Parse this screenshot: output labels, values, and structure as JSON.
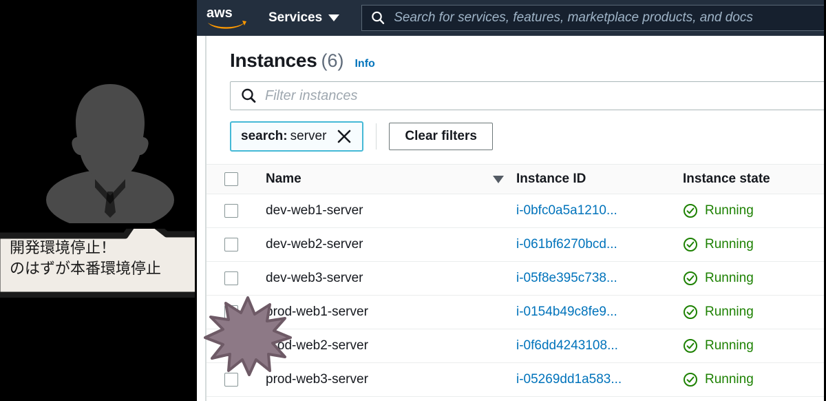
{
  "nav": {
    "logo": "aws-logo",
    "services_label": "Services",
    "search_placeholder": "Search for services, features, marketplace products, and docs",
    "search_icon": "search-icon",
    "caret_icon": "chevron-down-icon"
  },
  "page": {
    "title": "Instances",
    "count": "(6)",
    "info_label": "Info"
  },
  "filter": {
    "placeholder": "Filter instances",
    "search_icon": "search-icon",
    "chip_key": "search:",
    "chip_value": "server",
    "chip_remove_icon": "close-icon",
    "clear_label": "Clear filters"
  },
  "table": {
    "columns": [
      "Name",
      "Instance ID",
      "Instance state"
    ],
    "sort_icon": "sort-descending-icon",
    "rows": [
      {
        "name": "dev-web1-server",
        "id": "i-0bfc0a5a1210...",
        "state": "Running",
        "state_icon": "check-circle-icon"
      },
      {
        "name": "dev-web2-server",
        "id": "i-061bf6270bcd...",
        "state": "Running",
        "state_icon": "check-circle-icon"
      },
      {
        "name": "dev-web3-server",
        "id": "i-05f8e395c738...",
        "state": "Running",
        "state_icon": "check-circle-icon"
      },
      {
        "name": "prod-web1-server",
        "id": "i-0154b49c8fe9...",
        "state": "Running",
        "state_icon": "check-circle-icon"
      },
      {
        "name": "prod-web2-server",
        "id": "i-0f6dd4243108...",
        "state": "Running",
        "state_icon": "check-circle-icon"
      },
      {
        "name": "prod-web3-server",
        "id": "i-05269dd1a583...",
        "state": "Running",
        "state_icon": "check-circle-icon"
      }
    ]
  },
  "annotation": {
    "avatar_icon": "person-avatar-icon",
    "bubble_text": "開発環境停止！\nのはずが本番環境停止",
    "starburst_icon": "starburst-icon"
  },
  "colors": {
    "nav_bg": "#232f3e",
    "aws_orange": "#ff9900",
    "link_blue": "#0073bb",
    "chip_border": "#44b9d6",
    "running_green": "#1d8102",
    "starburst_fill": "#8d7986",
    "bubble_fill": "#f0ece6",
    "avatar_gray": "#4a4a4a"
  }
}
